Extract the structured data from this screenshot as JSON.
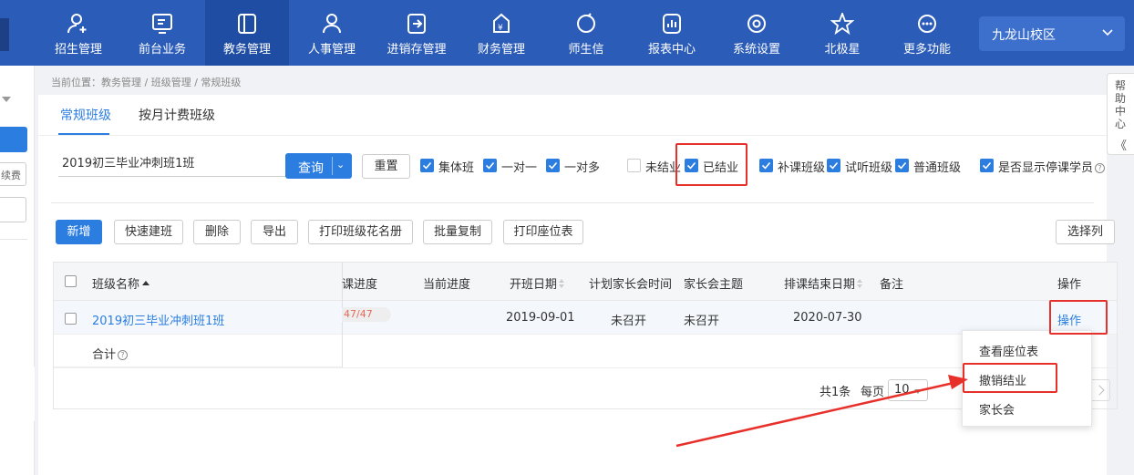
{
  "nav": {
    "items": [
      {
        "label": "招生管理",
        "icon": "user-add-icon"
      },
      {
        "label": "前台业务",
        "icon": "monitor-icon"
      },
      {
        "label": "教务管理",
        "icon": "book-icon",
        "active": true
      },
      {
        "label": "人事管理",
        "icon": "person-icon"
      },
      {
        "label": "进销存管理",
        "icon": "inventory-icon"
      },
      {
        "label": "财务管理",
        "icon": "money-bag-icon"
      },
      {
        "label": "师生信",
        "icon": "message-icon"
      },
      {
        "label": "报表中心",
        "icon": "report-icon"
      },
      {
        "label": "系统设置",
        "icon": "settings-icon"
      },
      {
        "label": "北极星",
        "icon": "star-icon"
      },
      {
        "label": "更多功能",
        "icon": "more-icon"
      }
    ],
    "campus": "九龙山校区"
  },
  "left_panel": {
    "box_text": "续费"
  },
  "breadcrumb": "当前位置：教务管理 / 班级管理 / 常规班级",
  "tabs": [
    {
      "label": "常规班级",
      "active": true
    },
    {
      "label": "按月计费班级",
      "active": false
    }
  ],
  "filters": {
    "search_value": "2019初三毕业冲刺班1班",
    "query_label": "查询",
    "reset_label": "重置",
    "checkboxes": [
      {
        "label": "集体班",
        "checked": true
      },
      {
        "label": "一对一",
        "checked": true
      },
      {
        "label": "一对多",
        "checked": true
      },
      {
        "label": "未结业",
        "checked": false
      },
      {
        "label": "已结业",
        "checked": true
      },
      {
        "label": "补课班级",
        "checked": true
      },
      {
        "label": "试听班级",
        "checked": true
      },
      {
        "label": "普通班级",
        "checked": true
      },
      {
        "label": "是否显示停课学员",
        "checked": true
      }
    ]
  },
  "toolbar": {
    "new": "新增",
    "quick": "快速建班",
    "delete": "删除",
    "export": "导出",
    "print_roster": "打印班级花名册",
    "batch_copy": "批量复制",
    "print_seat": "打印座位表",
    "select_columns": "选择列"
  },
  "table": {
    "headers": {
      "name": "班级名称",
      "sched_progress": "课进度",
      "current_progress": "当前进度",
      "start_date": "开班日期",
      "parent_meeting_time": "计划家长会时间",
      "parent_meeting_topic": "家长会主题",
      "end_date": "排课结束日期",
      "remark": "备注",
      "action": "操作"
    },
    "row": {
      "name": "2019初三毕业冲刺班1班",
      "progress": "47/47",
      "start_date": "2019-09-01",
      "meeting_time": "未召开",
      "meeting_topic": "未召开",
      "end_date": "2020-07-30",
      "action": "操作"
    },
    "total_label": "合计"
  },
  "pager": {
    "total": "共1条",
    "per_page_label": "每页",
    "page_size": "10"
  },
  "dropdown": {
    "items": [
      "查看座位表",
      "撤销结业",
      "家长会"
    ]
  },
  "help_tab": {
    "text": "帮助中心",
    "collapse": "《"
  },
  "colors": {
    "nav_bg": "#2b5cb8",
    "accent": "#2b7de0",
    "highlight": "#e8302a"
  }
}
